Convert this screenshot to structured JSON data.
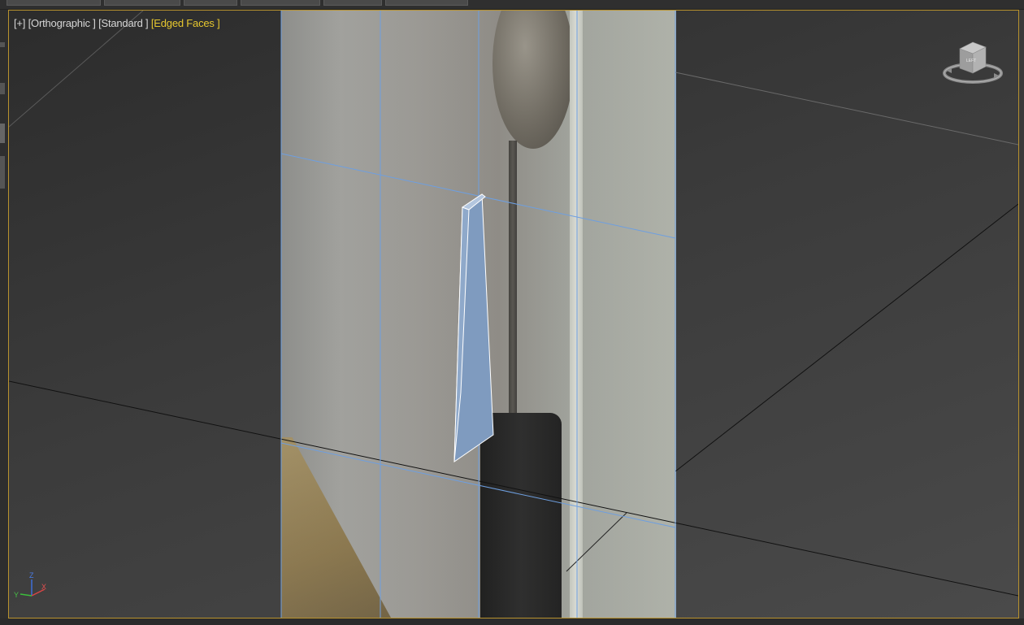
{
  "viewport": {
    "menu_plus": "[+]",
    "view_name": "[Orthographic ]",
    "shading_mode": "[Standard ]",
    "edged_faces": "[Edged Faces ]",
    "active_border_color": "#b8922e",
    "highlight_color": "#e6c72f"
  },
  "viewcube": {
    "face_label": "LEFT",
    "icon": "viewcube-icon"
  },
  "axis_tripod": {
    "z": "Z",
    "y": "Y",
    "x": "X",
    "icon": "axis-tripod-icon"
  },
  "scene": {
    "reference_plane": "image-plane",
    "selected_object": "wedge-shape",
    "selection_color": "#7f9bbf"
  }
}
